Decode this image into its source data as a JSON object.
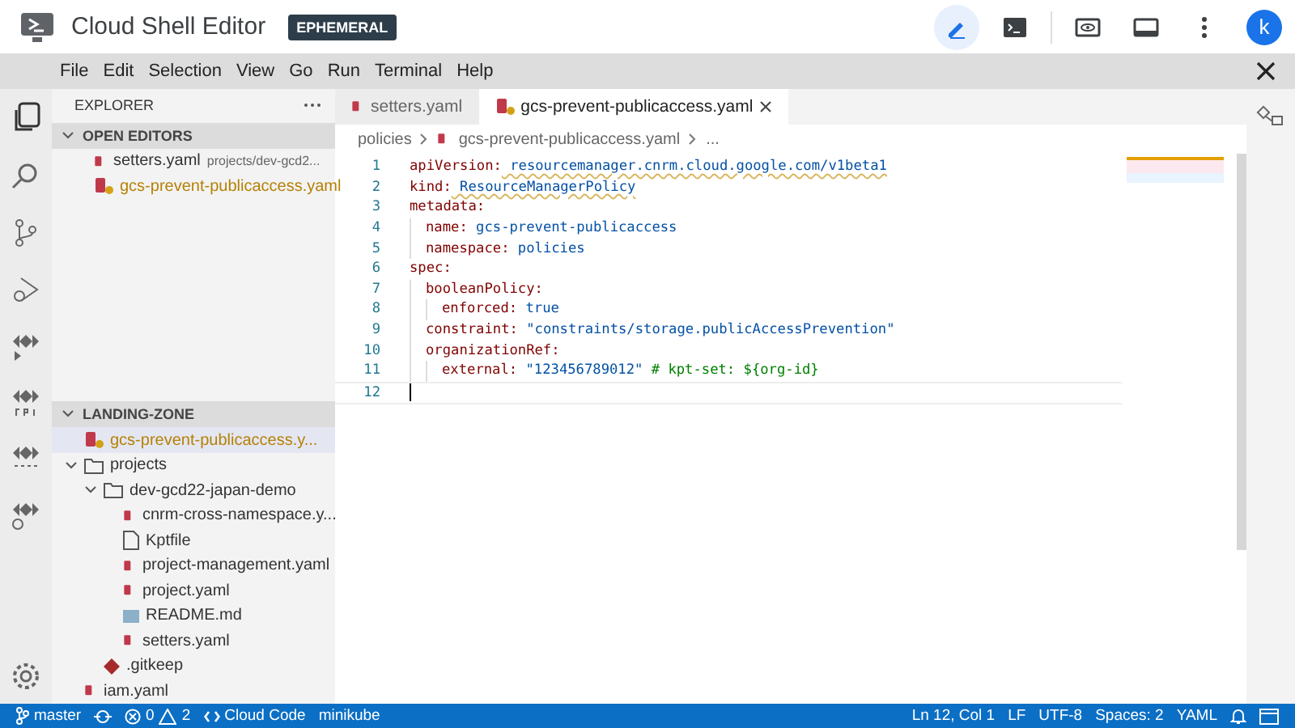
{
  "header": {
    "title": "Cloud Shell Editor",
    "badge": "EPHEMERAL",
    "avatar": "k"
  },
  "menu": [
    "File",
    "Edit",
    "Selection",
    "View",
    "Go",
    "Run",
    "Terminal",
    "Help"
  ],
  "explorer": {
    "title": "EXPLORER",
    "open_editors": {
      "title": "OPEN EDITORS",
      "expanded": true,
      "items": [
        {
          "name": "setters.yaml",
          "path": "projects/dev-gcd2...",
          "warning": false
        },
        {
          "name": "gcs-prevent-publicaccess.yaml",
          "warning": true
        }
      ]
    },
    "workspace": {
      "title": "LANDING-ZONE",
      "expanded": true,
      "items": [
        {
          "name": "gcs-prevent-publicaccess.y...",
          "kind": "yaml",
          "warning": true,
          "selected": true
        },
        {
          "name": "projects",
          "kind": "folder",
          "expanded": true,
          "selected": false,
          "children": [
            {
              "name": "dev-gcd22-japan-demo",
              "kind": "folder",
              "expanded": true,
              "selected": false,
              "children": [
                {
                  "name": "cnrm-cross-namespace.y...",
                  "kind": "yaml",
                  "warning": false,
                  "selected": false
                },
                {
                  "name": "Kptfile",
                  "kind": "file",
                  "warning": false,
                  "selected": false
                },
                {
                  "name": "project-management.yaml",
                  "kind": "yaml",
                  "warning": false,
                  "selected": false
                },
                {
                  "name": "project.yaml",
                  "kind": "yaml",
                  "warning": false,
                  "selected": false
                },
                {
                  "name": "README.md",
                  "kind": "markdown",
                  "warning": false,
                  "selected": false
                },
                {
                  "name": "setters.yaml",
                  "kind": "yaml",
                  "warning": false,
                  "selected": false
                }
              ]
            },
            {
              "name": ".gitkeep",
              "kind": "git",
              "warning": false,
              "selected": false
            }
          ]
        },
        {
          "name": "iam.yaml",
          "kind": "yaml",
          "warning": false,
          "selected": false
        }
      ]
    }
  },
  "tabs": [
    {
      "label": "setters.yaml",
      "selected": false,
      "warning": false
    },
    {
      "label": "gcs-prevent-publicaccess.yaml",
      "selected": true,
      "warning": true
    }
  ],
  "breadcrumb": [
    "policies",
    "gcs-prevent-publicaccess.yaml",
    "..."
  ],
  "code": [
    {
      "n": "1",
      "tokens": [
        {
          "text": "apiVersion:",
          "kind": "key"
        },
        {
          "text": " resourcemanager.cnrm.cloud.google.com/v1beta1",
          "kind": "link"
        }
      ]
    },
    {
      "n": "2",
      "tokens": [
        {
          "text": "kind:",
          "kind": "key"
        },
        {
          "text": " ResourceManagerPolicy",
          "kind": "link"
        }
      ]
    },
    {
      "n": "3",
      "tokens": [
        {
          "text": "metadata:",
          "kind": "key"
        }
      ],
      "children": [
        {
          "n": "4",
          "tokens": [
            {
              "text": "name:",
              "kind": "key"
            },
            {
              "text": " gcs-prevent-publicaccess",
              "kind": "value"
            }
          ]
        },
        {
          "n": "5",
          "tokens": [
            {
              "text": "namespace:",
              "kind": "key"
            },
            {
              "text": " policies",
              "kind": "value"
            }
          ]
        }
      ]
    },
    {
      "n": "6",
      "tokens": [
        {
          "text": "spec:",
          "kind": "key"
        }
      ],
      "children": [
        {
          "n": "7",
          "tokens": [
            {
              "text": "booleanPolicy:",
              "kind": "key"
            }
          ],
          "children": [
            {
              "n": "8",
              "tokens": [
                {
                  "text": "enforced:",
                  "kind": "key"
                },
                {
                  "text": " true",
                  "kind": "value"
                }
              ]
            }
          ]
        },
        {
          "n": "9",
          "tokens": [
            {
              "text": "constraint:",
              "kind": "key"
            },
            {
              "text": " \"constraints/storage.publicAccessPrevention\"",
              "kind": "string"
            }
          ]
        },
        {
          "n": "10",
          "tokens": [
            {
              "text": "organizationRef:",
              "kind": "key"
            }
          ],
          "children": [
            {
              "n": "11",
              "tokens": [
                {
                  "text": "external:",
                  "kind": "key"
                },
                {
                  "text": " \"123456789012\"",
                  "kind": "string"
                },
                {
                  "text": " # kpt-set: ${org-id}",
                  "kind": "comment"
                }
              ]
            }
          ]
        }
      ]
    },
    {
      "n": "12",
      "current": true
    }
  ],
  "status": {
    "branch": "master",
    "errors": "0",
    "warnings": "2",
    "cloud_code": "Cloud Code",
    "cluster": "minikube",
    "position": "Ln 12, Col 1",
    "eol": "LF",
    "encoding": "UTF-8",
    "spaces": "Spaces: 2",
    "language": "YAML"
  }
}
